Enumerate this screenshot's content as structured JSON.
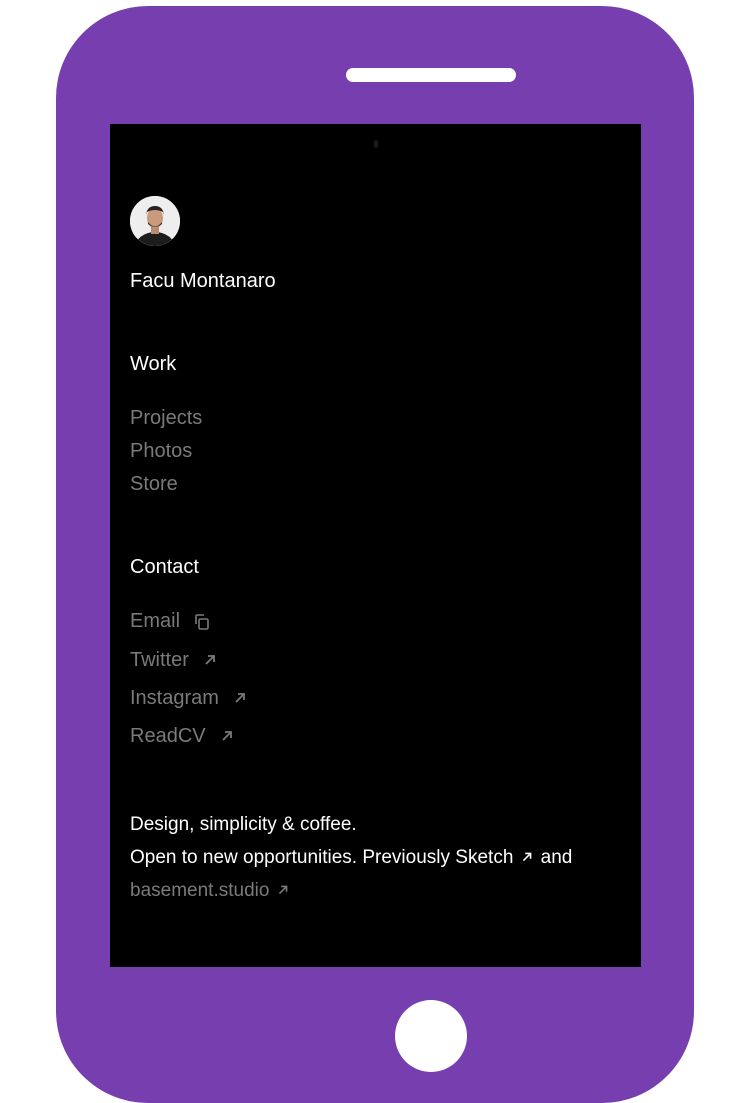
{
  "profile": {
    "name": "Facu Montanaro",
    "avatar_alt": "avatar"
  },
  "work": {
    "heading": "Work",
    "items": [
      {
        "label": "Projects"
      },
      {
        "label": "Photos"
      },
      {
        "label": "Store"
      }
    ]
  },
  "contact": {
    "heading": "Contact",
    "items": [
      {
        "label": "Email",
        "icon": "copy-icon"
      },
      {
        "label": "Twitter",
        "icon": "external-link-icon"
      },
      {
        "label": "Instagram",
        "icon": "external-link-icon"
      },
      {
        "label": "ReadCV",
        "icon": "external-link-icon"
      }
    ]
  },
  "bio": {
    "line1": "Design, simplicity & coffee.",
    "line2_prefix": "Open to new opportunities. Previously",
    "sketch_label": "Sketch",
    "and_text": "and",
    "basement_label": "basement.studio"
  },
  "colors": {
    "device_frame": "#763eaf",
    "screen_bg": "#000000",
    "primary_text": "#ffffff",
    "muted_text": "#7a7a7a"
  }
}
